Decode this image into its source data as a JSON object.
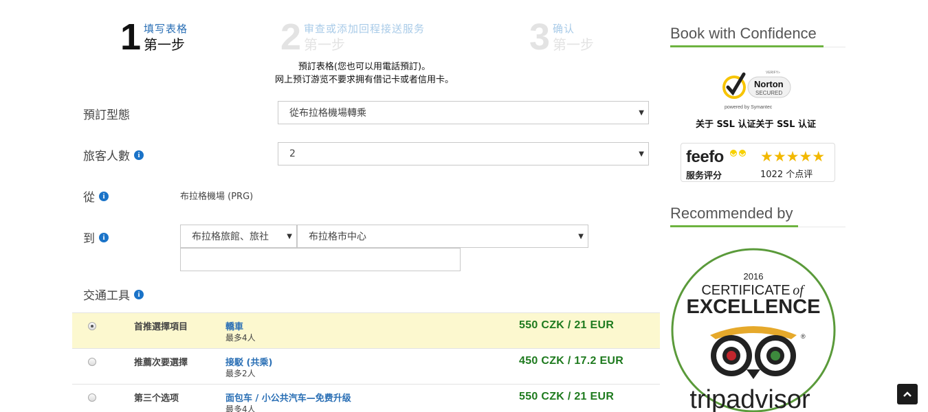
{
  "steps": [
    {
      "number": "1",
      "title": "填写表格",
      "subtitle": "第一步"
    },
    {
      "number": "2",
      "title": "审查或添加回程接送服务",
      "subtitle": "第一步"
    },
    {
      "number": "3",
      "title": "确认",
      "subtitle": "第一步"
    }
  ],
  "intro": {
    "line1": "預訂表格(您也可以用電話預訂)。",
    "line2": "网上预订游览不要求拥有借记卡或者信用卡。"
  },
  "form": {
    "booking_type": {
      "label": "預訂型態",
      "value": "從布拉格機場轉乘"
    },
    "passengers": {
      "label": "旅客人數",
      "value": "2"
    },
    "from": {
      "label": "從",
      "value": "布拉格機場 (PRG)"
    },
    "to": {
      "label": "到",
      "type_value": "布拉格旅館、旅社",
      "area_value": "布拉格市中心",
      "address_value": ""
    },
    "transport": {
      "label": "交通工具"
    }
  },
  "vehicles": [
    {
      "choice": "首推選擇項目",
      "name": "轎車",
      "capacity": "最多4人",
      "price": "550 CZK / 21 EUR",
      "selected": true
    },
    {
      "choice": "推薦次要選擇",
      "name": "接駁 (共乘)",
      "capacity": "最多2人",
      "price": "450 CZK / 17.2 EUR",
      "selected": false
    },
    {
      "choice": "第三个选项",
      "name": "面包车 / 小公共汽车—免费升级",
      "capacity": "最多4人",
      "price": "550 CZK / 21 EUR",
      "selected": false
    }
  ],
  "sidebar": {
    "confidence_heading": "Book with Confidence",
    "norton": {
      "verify": "VERIFY»",
      "brand": "Norton",
      "secured": "SECURED",
      "powered": "powered by Symantec"
    },
    "ssl_text": "关于 SSL 认证关于 SSL 认证",
    "feefo": {
      "logo": "feefo",
      "service": "服务评分",
      "stars": "★★★★★",
      "reviews": "1022 个点评"
    },
    "recommended_heading": "Recommended by",
    "tripadvisor": {
      "year": "2016",
      "certificate": "CERTIFICATE",
      "of": "of",
      "excellence": "EXCELLENCE",
      "brand": "tripadvisor"
    }
  },
  "info_icon": "i",
  "colors": {
    "accent_green": "#6db33f",
    "price_green": "#1e7a1e",
    "link_blue": "#2a6fb5",
    "selected_bg": "#fcf8cf"
  }
}
